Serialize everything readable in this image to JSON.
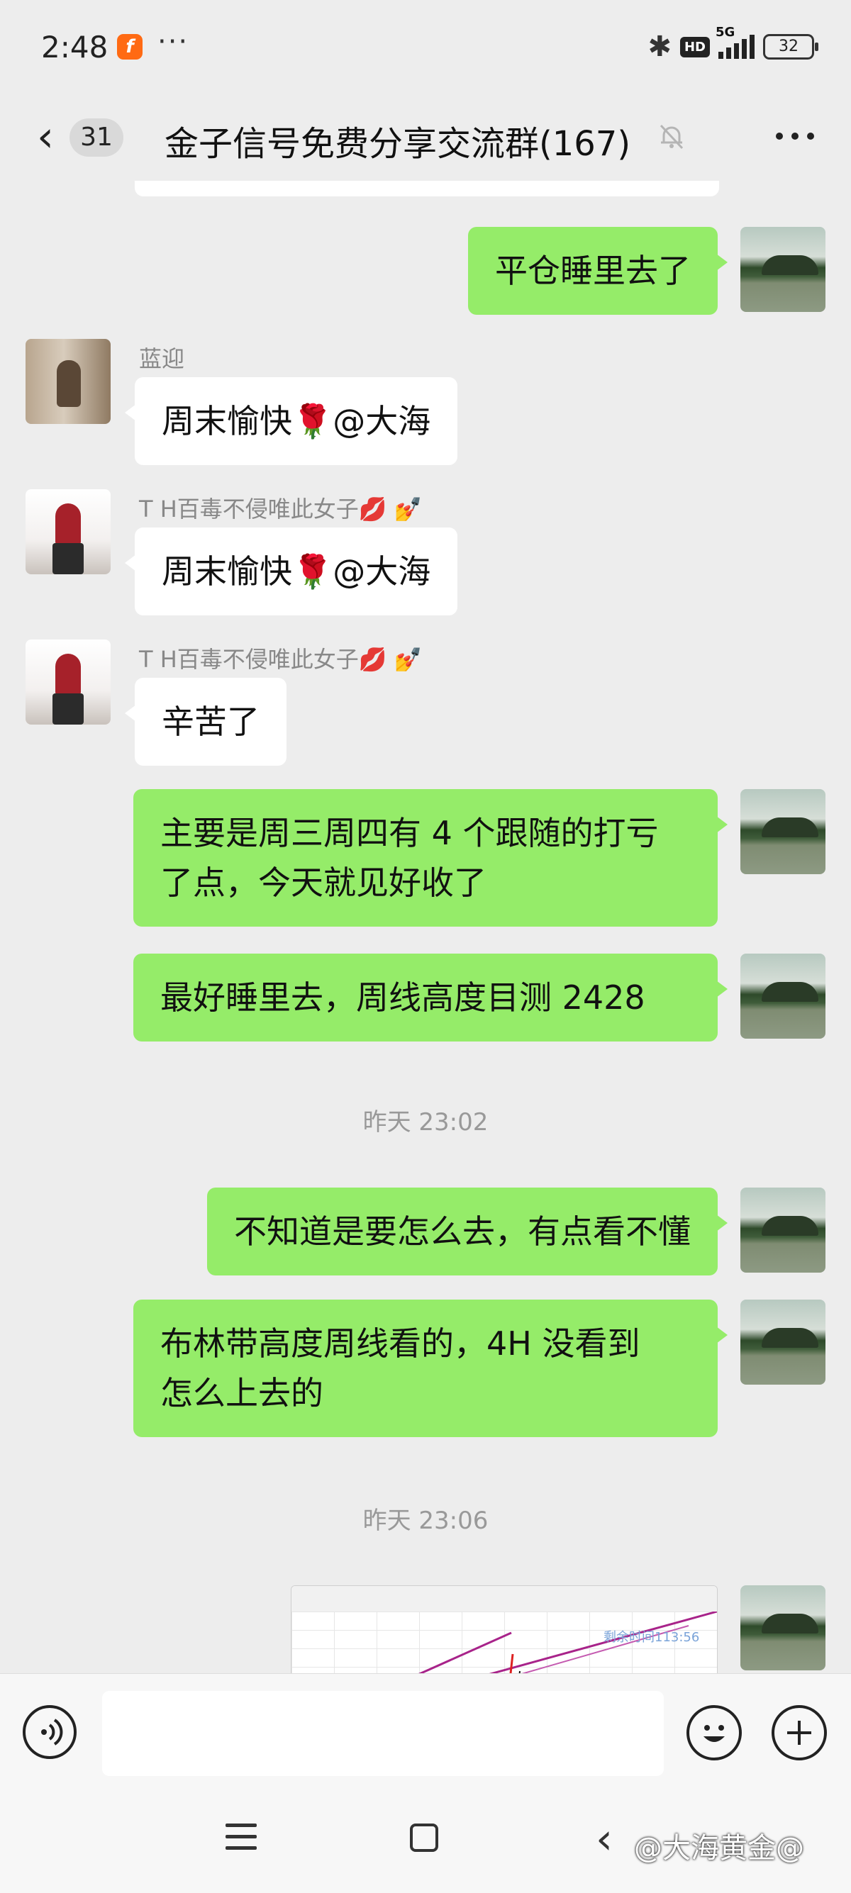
{
  "status_bar": {
    "time": "2:48",
    "app_icon_letter": "f",
    "more": "···",
    "bluetooth": "✱",
    "hd": "HD",
    "network": "5G",
    "battery": "32"
  },
  "header": {
    "unread_count": "31",
    "title": "金子信号免费分享交流群(167)"
  },
  "messages": [
    {
      "side": "me",
      "text": "平仓睡里去了"
    },
    {
      "side": "other",
      "sender": "蓝迎",
      "text_before": "周末愉快",
      "emoji": "🌹",
      "text_after": "@大海"
    },
    {
      "side": "other",
      "sender": "T H百毒不侵唯此女子💋 💅",
      "text_before": "周末愉快",
      "emoji": "🌹",
      "text_after": "@大海"
    },
    {
      "side": "other",
      "sender": "T H百毒不侵唯此女子💋 💅",
      "text": "辛苦了"
    },
    {
      "side": "me",
      "line1": "主要是周三周四有 4 个跟随的打亏",
      "line2": "了点，今天就见好收了"
    },
    {
      "side": "me",
      "text": "最好睡里去，周线高度目测 2428"
    },
    {
      "time": "昨天 23:02"
    },
    {
      "side": "me",
      "text": "不知道是要怎么去，有点看不懂"
    },
    {
      "side": "me",
      "line1": "布林带高度周线看的，4H 没看到",
      "line2": "怎么上去的"
    },
    {
      "time": "昨天 23:06"
    },
    {
      "side": "me",
      "image_caption": "剩余时间113:56"
    }
  ],
  "input": {
    "placeholder": ""
  },
  "watermark": "@大海黄金@",
  "colors": {
    "my_bubble": "#95ec69",
    "other_bubble": "#ffffff",
    "background": "#ededed"
  }
}
